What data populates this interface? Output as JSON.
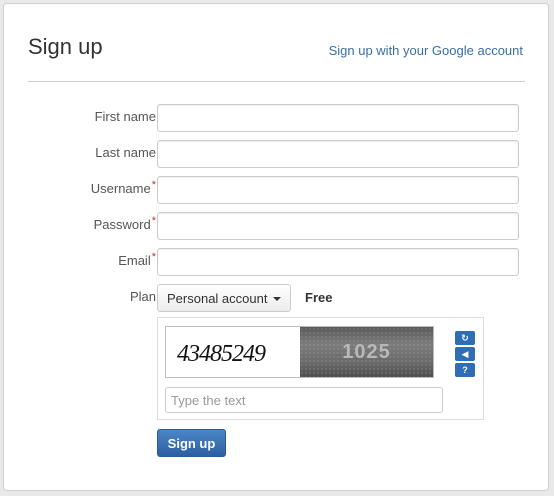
{
  "header": {
    "title": "Sign up",
    "google_link": "Sign up with your Google account"
  },
  "form": {
    "fields": [
      {
        "label": "First name",
        "required": false,
        "value": "",
        "placeholder": ""
      },
      {
        "label": "Last name",
        "required": false,
        "value": "",
        "placeholder": ""
      },
      {
        "label": "Username",
        "required": true,
        "value": "",
        "placeholder": ""
      },
      {
        "label": "Password",
        "required": true,
        "value": "",
        "placeholder": ""
      },
      {
        "label": "Email",
        "required": true,
        "value": "",
        "placeholder": ""
      }
    ],
    "required_marker": "*",
    "plan": {
      "label": "Plan",
      "selected": "Personal account",
      "price": "Free"
    },
    "captcha": {
      "image_text_left": "43485249",
      "image_text_right": "1025",
      "placeholder": "Type the text",
      "icons": [
        "refresh-icon",
        "audio-icon",
        "help-icon"
      ]
    },
    "submit_label": "Sign up"
  },
  "colors": {
    "link": "#3a6ea5",
    "required": "#c9302c",
    "primary_button": "#3a72b8"
  }
}
